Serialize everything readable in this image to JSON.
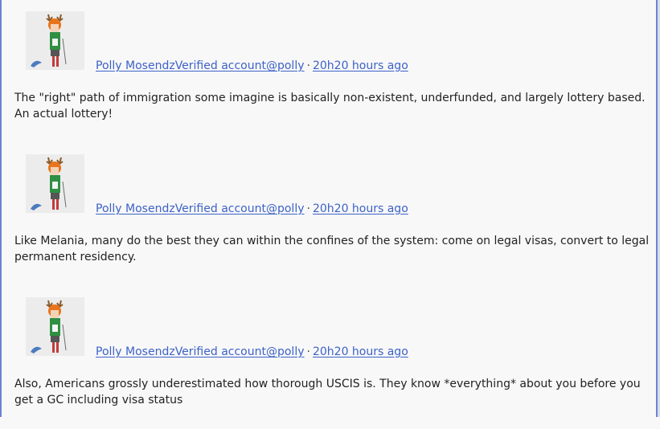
{
  "tweets": [
    {
      "author_name": "Polly Mosendz",
      "verified_label": "Verified account",
      "handle": "@polly",
      "separator": "·",
      "time_short": "20h",
      "time_long": "20 hours ago",
      "text": "The \"right\" path of immigration some imagine is basically non-existent, underfunded, and largely lottery based. An actual lottery!",
      "avatar_icon": "illustrated-girl-with-antlers-avatar"
    },
    {
      "author_name": "Polly Mosendz",
      "verified_label": "Verified account",
      "handle": "@polly",
      "separator": "·",
      "time_short": "20h",
      "time_long": "20 hours ago",
      "text": "Like Melania, many do the best they can within the confines of the system: come on legal visas, convert to legal permanent residency.",
      "avatar_icon": "illustrated-girl-with-antlers-avatar"
    },
    {
      "author_name": "Polly Mosendz",
      "verified_label": "Verified account",
      "handle": "@polly",
      "separator": "·",
      "time_short": "20h",
      "time_long": "20 hours ago",
      "text": "Also, Americans grossly underestimated how thorough USCIS is. They know *everything* about you before you get a GC including visa status",
      "avatar_icon": "illustrated-girl-with-antlers-avatar"
    }
  ],
  "colors": {
    "background": "#f8f8f9",
    "link": "#3d62c7",
    "text": "#222222",
    "frame": "#6b82d6"
  }
}
